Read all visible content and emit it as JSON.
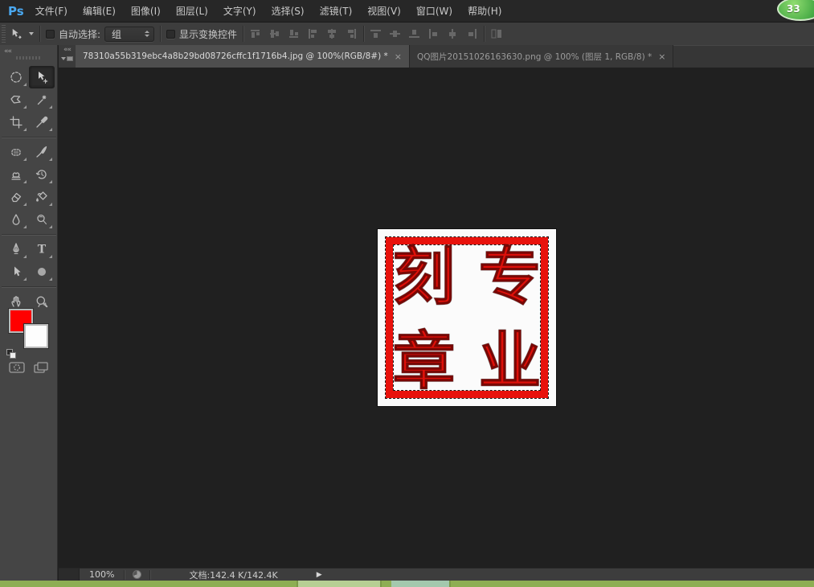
{
  "app": {
    "logo": "Ps",
    "badge_count": "33"
  },
  "menu_bar": {
    "items": [
      "文件(F)",
      "编辑(E)",
      "图像(I)",
      "图层(L)",
      "文字(Y)",
      "选择(S)",
      "滤镜(T)",
      "视图(V)",
      "窗口(W)",
      "帮助(H)"
    ]
  },
  "options_bar": {
    "tool": "move-tool",
    "auto_select_label": "自动选择:",
    "auto_select_checked": false,
    "auto_select_value": "组",
    "show_transform_label": "显示变换控件",
    "show_transform_checked": false,
    "align_icons": [
      "align-top-edges",
      "align-vertical-centers",
      "align-bottom-edges",
      "align-left-edges",
      "align-horizontal-centers",
      "align-right-edges",
      "distribute-top-edges",
      "distribute-vertical-centers",
      "distribute-bottom-edges",
      "distribute-left-edges",
      "distribute-horizontal-centers",
      "distribute-right-edges",
      "auto-align-layers"
    ]
  },
  "chrome": {
    "collapse_glyph": "««"
  },
  "tabs": [
    {
      "title": "78310a55b319ebc4a8b29bd08726cffc1f1716b4.jpg @ 100%(RGB/8#) *",
      "close_glyph": "×",
      "active": true
    },
    {
      "title": "QQ图片20151026163630.png @ 100% (图层 1, RGB/8) *",
      "close_glyph": "×",
      "active": false
    }
  ],
  "toolbar": {
    "tools": [
      "elliptical-marquee",
      "move",
      "polygonal-lasso",
      "magic-wand",
      "crop",
      "eyedropper",
      "spot-healing-brush",
      "brush",
      "clone-stamp",
      "history-brush",
      "eraser",
      "paint-bucket",
      "blur",
      "dodge",
      "pen",
      "type",
      "path-selection",
      "ellipse-shape",
      "hand",
      "zoom"
    ],
    "selected_tool": "move",
    "foreground_color": "#ff0000",
    "background_color": "#ffffff"
  },
  "stamp": {
    "characters": [
      "刻",
      "专",
      "章",
      "业"
    ],
    "reading": "专业刻章",
    "frame_color": "#e8120c",
    "text_color": "#de100a",
    "selection": "marching-ants"
  },
  "status_bar": {
    "zoom_level": "100%",
    "document_info": "文档:142.4 K/142.4K",
    "expand_glyph": "▶"
  },
  "colors": {
    "menubar_bg": "#272727",
    "optionsbar_bg": "#3d3d3d",
    "panel_bg": "#454545",
    "canvas_bg": "#202020",
    "active_tab_bg": "#4e4e4e",
    "taskbar_green": "#8dae53",
    "badge_green": "#43a843",
    "logo_blue": "#4aa8f0"
  }
}
